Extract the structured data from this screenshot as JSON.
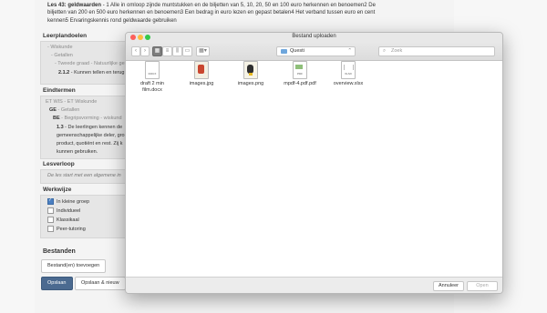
{
  "lesson": {
    "title": "Les 43: geldwaarden",
    "text": " - 1 Alle in omloop zijnde muntstukken en de biljetten van 5, 10, 20, 50 en 100 euro herkennen en benoemen2 De biljetten van 200 en 500 euro herkennen en benoemen3 Een bedrag in euro lezen en gepast betalen4 Het verband tussen euro en cent kennen5 Ervaringskennis rond geldwaarde gebruiken"
  },
  "leerplandoelen": {
    "heading": "Leerplandoelen",
    "lines": [
      "- Wiskunde",
      "- Getallen",
      "- Tweede graad - Natuurlijke ge"
    ],
    "item_code": "2.1.2",
    "item_text": " - Kunnen tellen en terug"
  },
  "eindtermen": {
    "heading": "Eindtermen",
    "l1": "ET WIS - ET Wiskunde",
    "l2a": "GE",
    "l2b": " - Getallen",
    "l3a": "BE",
    "l3b": " - Begripsvorming - wiskund",
    "code": "1.3",
    "t1": " - De leerlingen kennen de",
    "t2": "gemeenschappelijke deler, gro",
    "t3": "product, quotiënt en rest. Zij k",
    "t4": "kunnen gebruiken."
  },
  "lesverloop": {
    "heading": "Lesverloop",
    "text": "De les start met een algemene in"
  },
  "werkwijze": {
    "heading": "Werkwijze",
    "options": [
      {
        "label": "In kleine groep",
        "checked": true
      },
      {
        "label": "Individueel",
        "checked": false
      },
      {
        "label": "Klassikaal",
        "checked": false
      },
      {
        "label": "Peer-tutoring",
        "checked": false
      }
    ]
  },
  "bestanden": {
    "heading": "Bestanden",
    "add_button": "Bestand(en) toevoegen"
  },
  "actions": {
    "save": "Opslaan",
    "save_new": "Opslaan & nieuw"
  },
  "dialog": {
    "title": "Bestand uploaden",
    "location": "Questi",
    "search_placeholder": "Zoek",
    "files": [
      {
        "name": "draft 2 min film.docx",
        "kind": "DOCX"
      },
      {
        "name": "images.jpg",
        "kind": "image"
      },
      {
        "name": "images.png",
        "kind": "image"
      },
      {
        "name": "mpdf-4.pdf.pdf",
        "kind": "PDF"
      },
      {
        "name": "overview.xlsx",
        "kind": "XLSX"
      }
    ],
    "cancel": "Annuleer",
    "open": "Open"
  },
  "colors": {
    "primary_button": "#4b6a90",
    "folder": "#6ea6dc",
    "close": "#fc605c",
    "minimize": "#fdbc40",
    "zoom": "#34c84a"
  }
}
